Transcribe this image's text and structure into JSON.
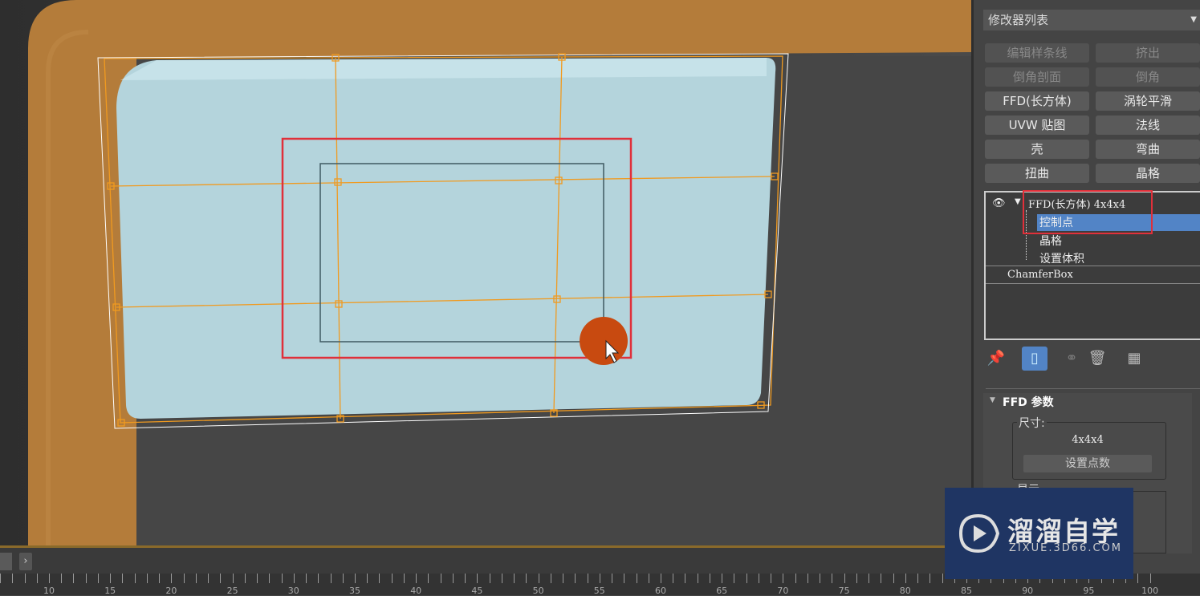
{
  "modifier_list": {
    "label": "修改器列表"
  },
  "modifier_buttons": [
    {
      "label": "编辑样条线",
      "disabled": true
    },
    {
      "label": "挤出",
      "disabled": true
    },
    {
      "label": "倒角剖面",
      "disabled": true
    },
    {
      "label": "倒角",
      "disabled": true
    },
    {
      "label": "FFD(长方体)",
      "disabled": false
    },
    {
      "label": "涡轮平滑",
      "disabled": false
    },
    {
      "label": "UVW 贴图",
      "disabled": false
    },
    {
      "label": "法线",
      "disabled": false
    },
    {
      "label": "壳",
      "disabled": false
    },
    {
      "label": "弯曲",
      "disabled": false
    },
    {
      "label": "扭曲",
      "disabled": false
    },
    {
      "label": "晶格",
      "disabled": false
    }
  ],
  "stack": {
    "modifier": "FFD(长方体) 4x4x4",
    "sub": [
      "控制点",
      "晶格",
      "设置体积"
    ],
    "selected": "控制点",
    "base": "ChamferBox"
  },
  "params": {
    "rollout_title": "FFD 参数",
    "dimensions_label": "尺寸:",
    "dimensions_value": "4x4x4",
    "set_points": "设置点数",
    "display_label": "显示"
  },
  "timeline": {
    "ticks": [
      10,
      15,
      20,
      25,
      30,
      35,
      40,
      45,
      50,
      55,
      60,
      65,
      70,
      75,
      80,
      85,
      90,
      95,
      100
    ]
  },
  "watermark": {
    "title": "溜溜自学",
    "url": "ZIXUE.3D66.COM"
  },
  "colors": {
    "selection": "#5284c6",
    "highlight": "#e0303a",
    "lattice": "#f09a20",
    "object": "#b4d4dc",
    "frame": "#b47c3a"
  }
}
